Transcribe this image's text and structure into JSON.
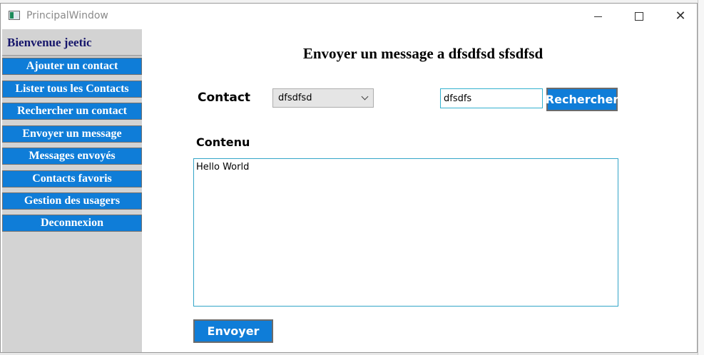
{
  "window": {
    "title": "PrincipalWindow"
  },
  "sidebar": {
    "welcome": "Bienvenue jeetic",
    "items": [
      {
        "label": "Ajouter un contact"
      },
      {
        "label": "Lister tous les Contacts"
      },
      {
        "label": "Rechercher un contact"
      },
      {
        "label": "Envoyer un message"
      },
      {
        "label": "Messages envoyés"
      },
      {
        "label": "Contacts favoris"
      },
      {
        "label": "Gestion des usagers"
      },
      {
        "label": "Deconnexion"
      }
    ]
  },
  "main": {
    "heading": "Envoyer un message a dfsdfsd sfsdfsd",
    "contact_label": "Contact",
    "contact_selected": "dfsdfsd",
    "search_value": "dfsdfs",
    "search_button": "Rechercher",
    "content_label": "Contenu",
    "content_value": "Hello World",
    "send_button": "Envoyer"
  },
  "colors": {
    "accent": "#0f7dd8",
    "sidebar_bg": "#d3d3d3",
    "welcome_text": "#16166b",
    "input_border": "#33b1cf"
  }
}
